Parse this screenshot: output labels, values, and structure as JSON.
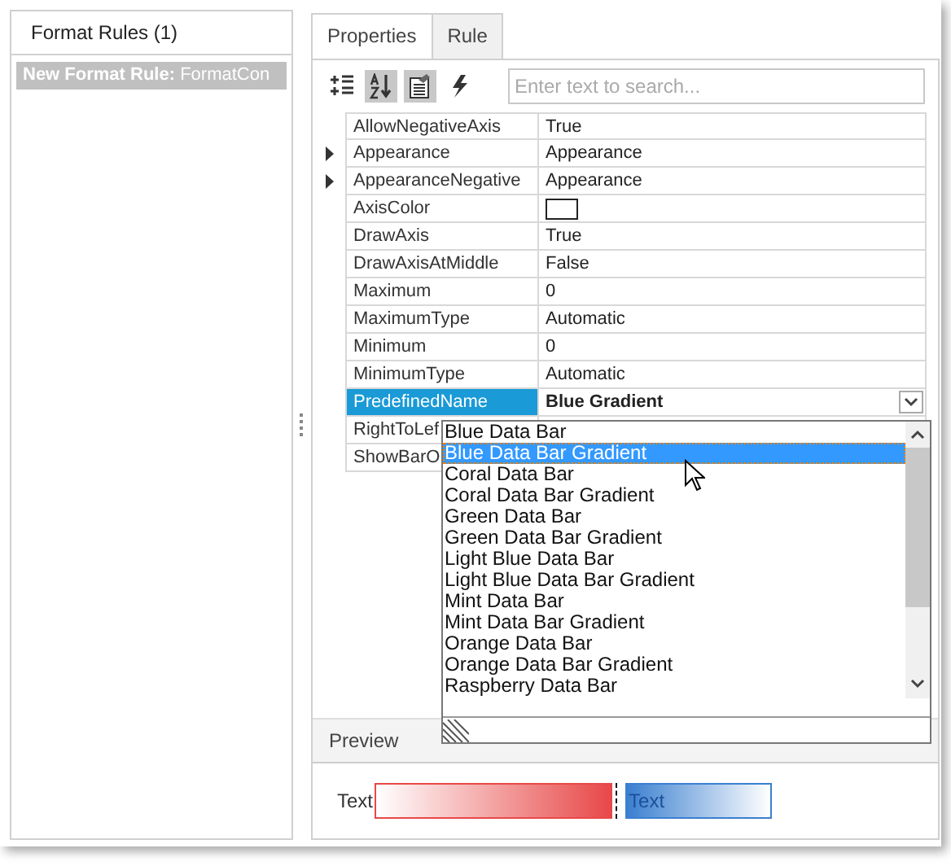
{
  "left_panel": {
    "title": "Format Rules (1)",
    "items": [
      {
        "name": "New Format Rule:",
        "value": "FormatCon",
        "selected": true
      }
    ]
  },
  "tabs": [
    {
      "label": "Properties",
      "selected": false
    },
    {
      "label": "Rule",
      "selected": true
    }
  ],
  "toolbar": {
    "buttons": [
      {
        "kind": "categorized",
        "selected": false
      },
      {
        "kind": "alphabetical",
        "selected": true
      },
      {
        "kind": "properties",
        "selected": true
      },
      {
        "kind": "events",
        "selected": false
      }
    ],
    "search": {
      "placeholder": "Enter text to search..."
    }
  },
  "properties": [
    {
      "name": "AllowNegativeAxis",
      "kind": "text",
      "value": "True",
      "expandable": false,
      "selected": false
    },
    {
      "name": "Appearance",
      "kind": "text",
      "value": "Appearance",
      "expandable": true,
      "selected": false
    },
    {
      "name": "AppearanceNegative",
      "kind": "text",
      "value": "Appearance",
      "expandable": true,
      "selected": false
    },
    {
      "name": "AxisColor",
      "kind": "color",
      "expandable": false,
      "selected": false
    },
    {
      "name": "DrawAxis",
      "kind": "text",
      "value": "True",
      "expandable": false,
      "selected": false
    },
    {
      "name": "DrawAxisAtMiddle",
      "kind": "text",
      "value": "False",
      "expandable": false,
      "selected": false
    },
    {
      "name": "Maximum",
      "kind": "text",
      "value": "0",
      "expandable": false,
      "selected": false
    },
    {
      "name": "MaximumType",
      "kind": "text",
      "value": "Automatic",
      "expandable": false,
      "selected": false
    },
    {
      "name": "Minimum",
      "kind": "text",
      "value": "0",
      "expandable": false,
      "selected": false
    },
    {
      "name": "MinimumType",
      "kind": "text",
      "value": "Automatic",
      "expandable": false,
      "selected": false
    },
    {
      "name": "PredefinedName",
      "kind": "dropdown",
      "value": "Blue Gradient",
      "expandable": false,
      "selected": true
    },
    {
      "name": "RightToLef",
      "kind": "hidden",
      "expandable": false,
      "selected": false
    },
    {
      "name": "ShowBarO",
      "kind": "hidden",
      "expandable": false,
      "selected": false
    }
  ],
  "dropdown": {
    "items": [
      {
        "label": "Blue Data Bar",
        "selected": false
      },
      {
        "label": "Blue Data Bar Gradient",
        "selected": true
      },
      {
        "label": "Coral Data Bar",
        "selected": false
      },
      {
        "label": "Coral Data Bar Gradient",
        "selected": false
      },
      {
        "label": "Green Data Bar",
        "selected": false
      },
      {
        "label": "Green Data Bar Gradient",
        "selected": false
      },
      {
        "label": "Light Blue Data Bar",
        "selected": false
      },
      {
        "label": "Light Blue Data Bar Gradient",
        "selected": false
      },
      {
        "label": "Mint Data Bar",
        "selected": false
      },
      {
        "label": "Mint Data Bar Gradient",
        "selected": false
      },
      {
        "label": "Orange Data Bar",
        "selected": false
      },
      {
        "label": "Orange Data Bar Gradient",
        "selected": false
      },
      {
        "label": "Raspberry Data Bar",
        "selected": false
      }
    ]
  },
  "preview": {
    "title": "Preview",
    "label": "Text",
    "bar_text": "Text"
  }
}
